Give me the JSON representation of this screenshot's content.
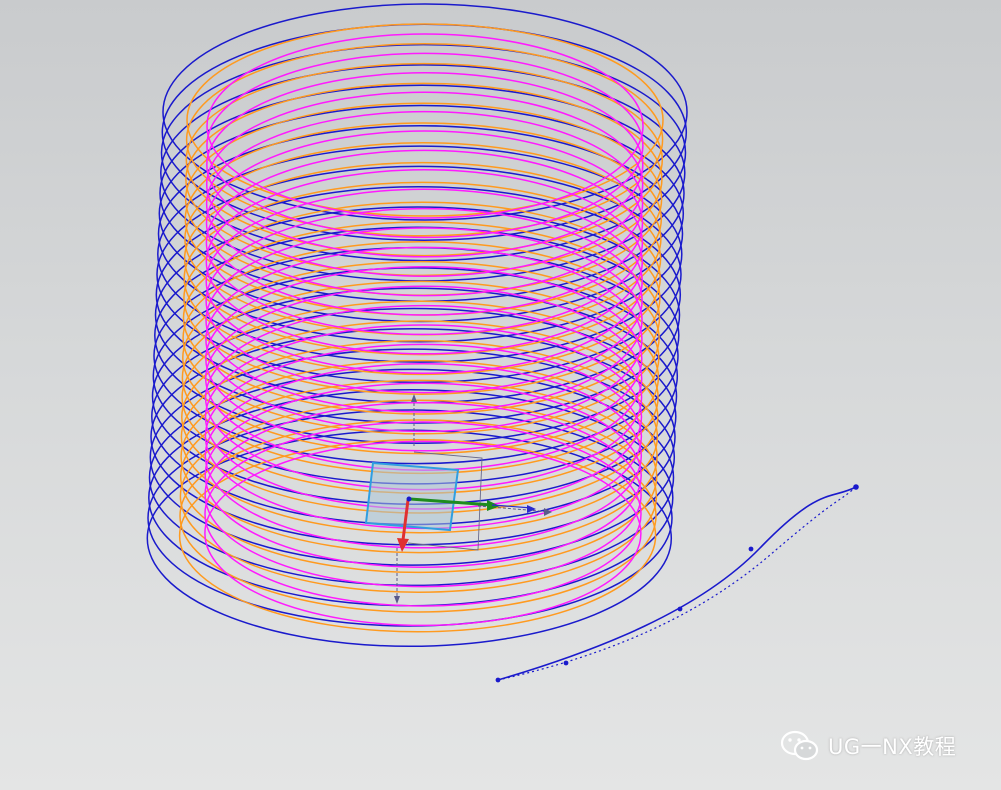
{
  "viewport": {
    "background_top": "#c9cbcd",
    "background_bottom": "#e4e5e5"
  },
  "model": {
    "description_icon": "helix-coil-curves",
    "curve_colors": {
      "outer_helix": "#1a1acc",
      "middle_helix": "#ff9a1f",
      "inner_helix": "#ff1aff",
      "spline": "#1a1acc"
    },
    "coil_turns": 22
  },
  "triad": {
    "icon": "wcs-triad-icon",
    "x_axis_color": "#1e8c1e",
    "z_axis_color": "#e03030",
    "plane_color": "#49a8e0"
  },
  "watermark": {
    "icon": "wechat-icon",
    "text": "UG一NX教程"
  }
}
